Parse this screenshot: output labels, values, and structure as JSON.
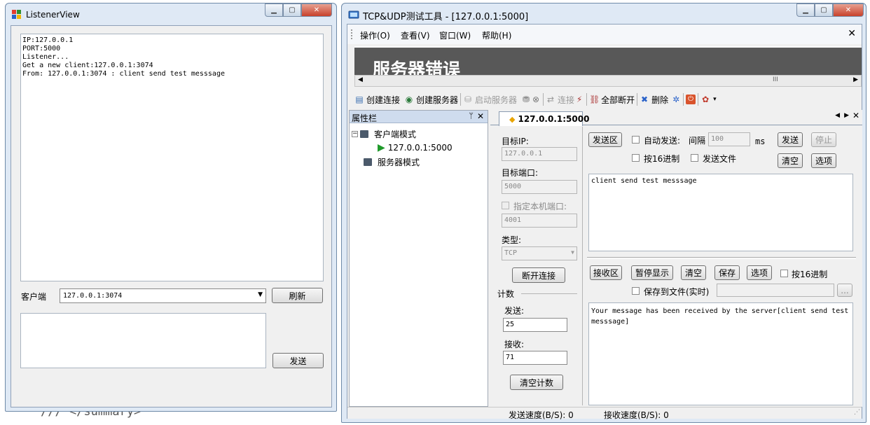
{
  "background": {
    "code": "/// </summary>"
  },
  "listener": {
    "title": "ListenerView",
    "log": [
      "IP:127.0.0.1",
      "PORT:5000",
      "Listener...",
      "Get a new client:127.0.0.1:3074",
      "From: 127.0.0.1:3074 : client send test messsage"
    ],
    "client_label": "客户端",
    "client_value": "127.0.0.1:3074",
    "refresh_label": "刷新",
    "send_label": "发送"
  },
  "tool": {
    "title": "TCP&UDP测试工具 - [127.0.0.1:5000]",
    "menu": [
      "操作(O)",
      "查看(V)",
      "窗口(W)",
      "帮助(H)"
    ],
    "banner": "服务器错误",
    "scroll_mark": "III",
    "toolbar": {
      "create_conn": "创建连接",
      "create_server": "创建服务器",
      "start_server": "启动服务器",
      "connect": "连接",
      "disconnect_all": "全部断开",
      "delete": "删除"
    },
    "panel": {
      "title": "属性栏",
      "pin": "ᛘ",
      "tree_client_mode": "客户端模式",
      "tree_conn": "127.0.0.1:5000",
      "tree_server_mode": "服务器模式"
    },
    "tab": {
      "label": "127.0.0.1:5000"
    },
    "left": {
      "target_ip_label": "目标IP:",
      "target_ip": "127.0.0.1",
      "target_port_label": "目标端口:",
      "target_port": "5000",
      "local_port_label": "指定本机端口:",
      "local_port": "4001",
      "type_label": "类型:",
      "type_value": "TCP",
      "disconnect_btn": "断开连接",
      "count_label": "计数",
      "send_count_label": "发送:",
      "send_count": "25",
      "recv_count_label": "接收:",
      "recv_count": "71",
      "clear_count_btn": "清空计数"
    },
    "send": {
      "area_btn": "发送区",
      "auto_send": "自动发送:",
      "interval_label": "间隔",
      "interval": "100",
      "unit": "ms",
      "send_btn": "发送",
      "stop_btn": "停止",
      "hex": "按16进制",
      "send_file": "发送文件",
      "clear_btn": "清空",
      "options_btn": "选项",
      "text": "client send test messsage"
    },
    "recv": {
      "area_btn": "接收区",
      "pause_btn": "暂停显示",
      "clear_btn": "清空",
      "save_btn": "保存",
      "options_btn": "选项",
      "hex": "按16进制",
      "save_file": "保存到文件(实时)",
      "browse_btn": "...",
      "text": "Your message has been received by the server[client send test messsage]"
    },
    "status": {
      "send_speed": "发送速度(B/S): 0",
      "recv_speed": "接收速度(B/S): 0"
    }
  }
}
